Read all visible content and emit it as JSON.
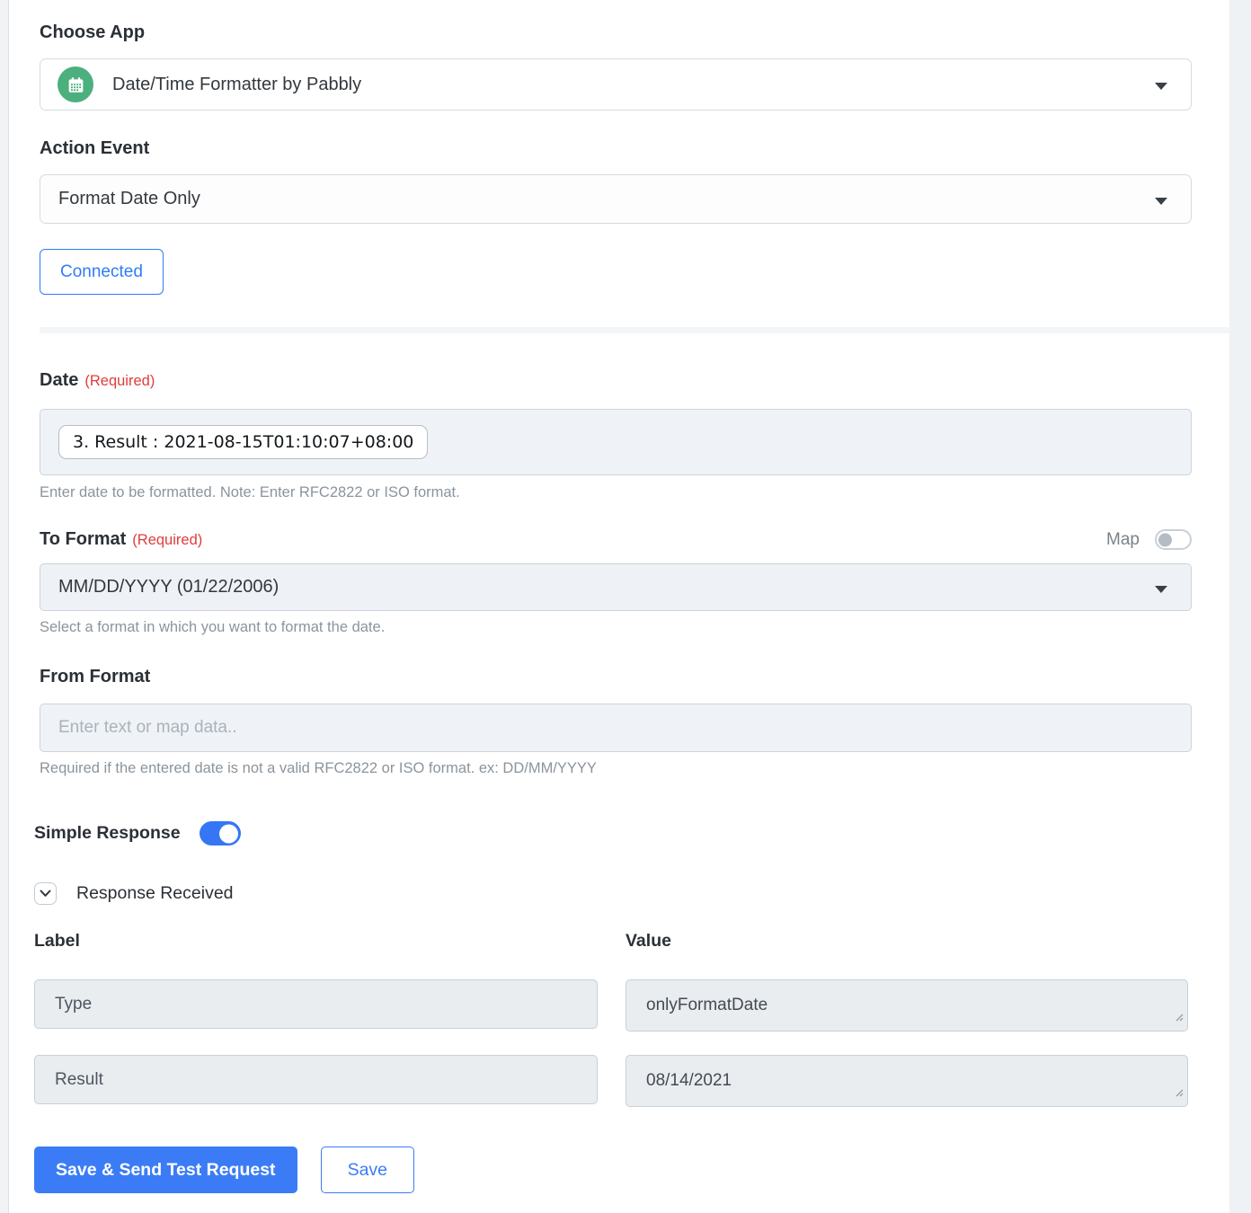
{
  "app_section": {
    "choose_app_label": "Choose App",
    "app_value": "Date/Time Formatter by Pabbly",
    "action_event_label": "Action Event",
    "action_event_value": "Format Date Only",
    "connected_button": "Connected"
  },
  "date_field": {
    "label": "Date",
    "required": "(Required)",
    "token": "3. Result : 2021-08-15T01:10:07+08:00",
    "helper": "Enter date to be formatted. Note: Enter RFC2822 or ISO format."
  },
  "to_format": {
    "label": "To Format",
    "required": "(Required)",
    "map_label": "Map",
    "map_enabled": false,
    "value": "MM/DD/YYYY (01/22/2006)",
    "helper": "Select a format in which you want to format the date."
  },
  "from_format": {
    "label": "From Format",
    "placeholder": "Enter text or map data..",
    "helper": "Required if the entered date is not a valid RFC2822 or ISO format. ex: DD/MM/YYYY"
  },
  "simple_response": {
    "label": "Simple Response",
    "enabled": true
  },
  "response_received": {
    "label": "Response Received"
  },
  "response_table": {
    "label_header": "Label",
    "value_header": "Value",
    "rows": [
      {
        "label": "Type",
        "value": "onlyFormatDate"
      },
      {
        "label": "Result",
        "value": "08/14/2021"
      }
    ]
  },
  "actions": {
    "save_send_label": "Save & Send Test Request",
    "save_label": "Save"
  },
  "icons": {
    "app_icon": "calendar-icon",
    "select_caret": "caret-down-icon",
    "response_collapse": "chevron-down-icon"
  },
  "colors": {
    "primary_blue": "#3b7cf6",
    "toggle_blue": "#3576f5",
    "icon_green": "#4caf7e",
    "required_red": "#e03c3c",
    "field_bg": "#eff3f7",
    "readonly_bg": "#e9edf0"
  }
}
